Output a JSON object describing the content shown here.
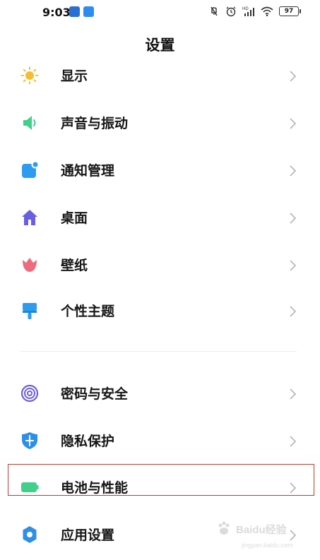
{
  "status_bar": {
    "time": "9:03",
    "battery_level": "97",
    "signal_tag": "HD"
  },
  "header": {
    "title": "设置"
  },
  "settings": {
    "items": [
      {
        "label": "显示",
        "icon": "sun-icon",
        "color": "#f5bd2a"
      },
      {
        "label": "声音与振动",
        "icon": "speaker-icon",
        "color": "#3fd18a"
      },
      {
        "label": "通知管理",
        "icon": "notification-icon",
        "color": "#2d9cf0"
      },
      {
        "label": "桌面",
        "icon": "home-icon",
        "color": "#6a5fe0"
      },
      {
        "label": "壁纸",
        "icon": "tulip-icon",
        "color": "#ee6b7d"
      },
      {
        "label": "个性主题",
        "icon": "paint-brush-icon",
        "color": "#2d9cf0"
      },
      {
        "label": "密码与安全",
        "icon": "fingerprint-icon",
        "color": "#6b5fd8"
      },
      {
        "label": "隐私保护",
        "icon": "shield-icon",
        "color": "#2d8fe6"
      },
      {
        "label": "电池与性能",
        "icon": "battery-icon",
        "color": "#3fd18a"
      },
      {
        "label": "应用设置",
        "icon": "gear-icon",
        "color": "#2d8fe6"
      }
    ]
  },
  "watermark": {
    "brand": "Baidu经验",
    "url": "jingyan.baidu.com"
  }
}
